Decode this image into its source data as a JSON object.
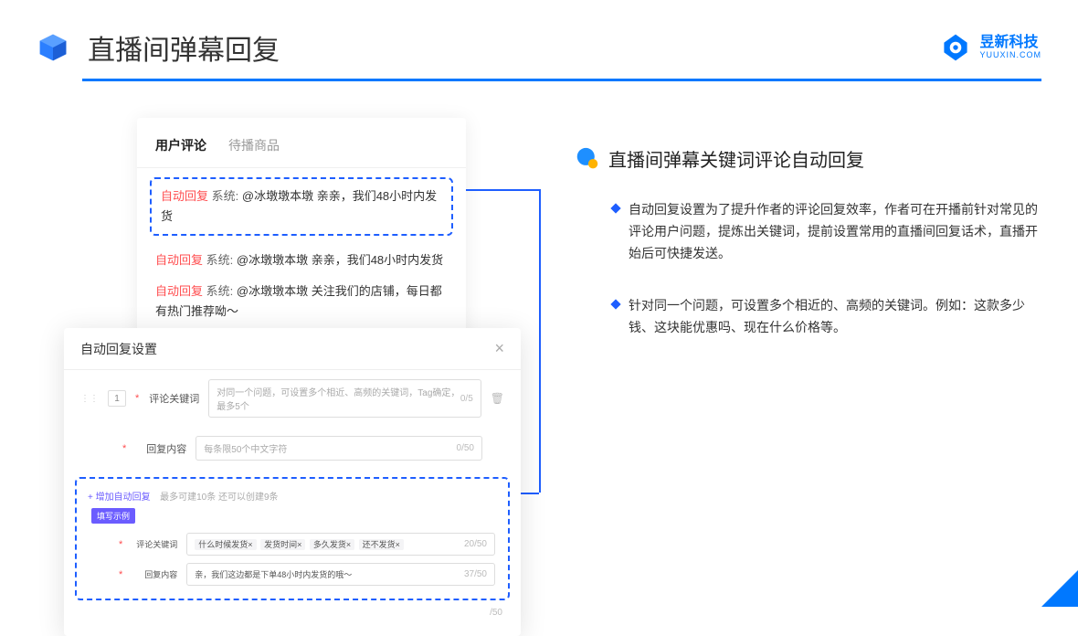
{
  "header": {
    "title": "直播间弹幕回复",
    "logo_cn": "昱新科技",
    "logo_en": "YUUXIN.COM"
  },
  "card": {
    "tab_active": "用户评论",
    "tab_inactive": "待播商品",
    "highlighted": {
      "tag": "自动回复",
      "sys": "系统:",
      "text": "@冰墩墩本墩 亲亲，我们48小时内发货"
    },
    "rows": [
      {
        "tag": "自动回复",
        "sys": "系统:",
        "text": "@冰墩墩本墩 亲亲，我们48小时内发货"
      },
      {
        "tag": "自动回复",
        "sys": "系统:",
        "text": "@冰墩墩本墩 关注我们的店铺，每日都有热门推荐呦～"
      }
    ]
  },
  "modal": {
    "title": "自动回复设置",
    "idx": "1",
    "label_keyword": "评论关键词",
    "placeholder_keyword": "对同一个问题，可设置多个相近、高频的关键词，Tag确定，最多5个",
    "counter_keyword": "0/5",
    "label_content": "回复内容",
    "placeholder_content": "每条限50个中文字符",
    "counter_content": "0/50",
    "add_link": "+ 增加自动回复",
    "add_hint": "最多可建10条 还可以创建9条",
    "example_badge": "填写示例",
    "ex_label_keyword": "评论关键词",
    "ex_tags": [
      "什么时候发货×",
      "发货时间×",
      "多久发货×",
      "还不发货×"
    ],
    "ex_counter_keyword": "20/50",
    "ex_label_content": "回复内容",
    "ex_content": "亲，我们这边都是下单48小时内发货的哦～",
    "ex_counter_content": "37/50",
    "outer_counter": "/50"
  },
  "right": {
    "section_title": "直播间弹幕关键词评论自动回复",
    "bullets": [
      "自动回复设置为了提升作者的评论回复效率，作者可在开播前针对常见的评论用户问题，提炼出关键词，提前设置常用的直播间回复话术，直播开始后可快捷发送。",
      "针对同一个问题，可设置多个相近的、高频的关键词。例如：这款多少钱、这块能优惠吗、现在什么价格等。"
    ]
  }
}
